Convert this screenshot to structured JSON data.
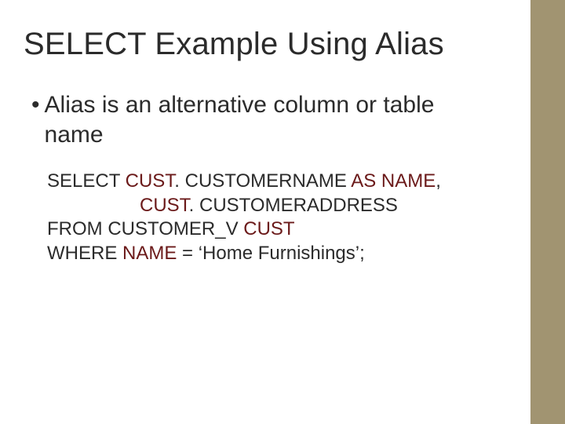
{
  "slide": {
    "title": "SELECT Example Using Alias",
    "bullet": {
      "marker": "•",
      "text_line1": "Alias is an alternative column or table",
      "text_line2": "name"
    },
    "code": {
      "l1a": "SELECT ",
      "l1b": "CUST",
      "l1c": ". CUSTOMERNAME ",
      "l1d": "AS NAME",
      "l1e": ",",
      "l2a": "CUST",
      "l2b": ". CUSTOMERADDRESS",
      "l3a": "FROM CUSTOMER_V ",
      "l3b": "CUST",
      "l4a": "WHERE ",
      "l4b": "NAME",
      "l4c": " = ‘Home Furnishings’;"
    }
  }
}
